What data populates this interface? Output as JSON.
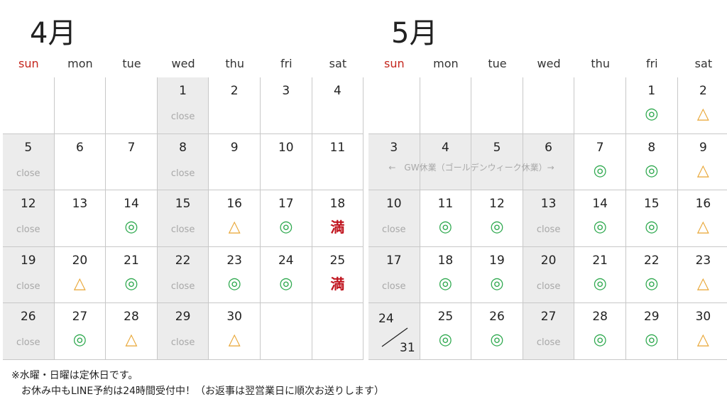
{
  "april": {
    "title": "4月",
    "dow": [
      "sun",
      "mon",
      "tue",
      "wed",
      "thu",
      "fri",
      "sat"
    ],
    "weeks": [
      [
        null,
        null,
        null,
        {
          "d": "1",
          "c": true
        },
        {
          "d": "2"
        },
        {
          "d": "3"
        },
        {
          "d": "4"
        }
      ],
      [
        {
          "d": "5",
          "c": true
        },
        {
          "d": "6"
        },
        {
          "d": "7"
        },
        {
          "d": "8",
          "c": true
        },
        {
          "d": "9"
        },
        {
          "d": "10"
        },
        {
          "d": "11"
        }
      ],
      [
        {
          "d": "12",
          "c": true
        },
        {
          "d": "13"
        },
        {
          "d": "14",
          "s": "◎"
        },
        {
          "d": "15",
          "c": true
        },
        {
          "d": "16",
          "s": "△"
        },
        {
          "d": "17",
          "s": "◎"
        },
        {
          "d": "18",
          "s": "満"
        }
      ],
      [
        {
          "d": "19",
          "c": true
        },
        {
          "d": "20",
          "s": "△"
        },
        {
          "d": "21",
          "s": "◎"
        },
        {
          "d": "22",
          "c": true
        },
        {
          "d": "23",
          "s": "◎"
        },
        {
          "d": "24",
          "s": "◎"
        },
        {
          "d": "25",
          "s": "満"
        }
      ],
      [
        {
          "d": "26",
          "c": true
        },
        {
          "d": "27",
          "s": "◎"
        },
        {
          "d": "28",
          "s": "△"
        },
        {
          "d": "29",
          "c": true
        },
        {
          "d": "30",
          "s": "△"
        },
        null,
        null
      ]
    ]
  },
  "may": {
    "title": "5月",
    "dow": [
      "sun",
      "mon",
      "tue",
      "wed",
      "thu",
      "fri",
      "sat"
    ],
    "weeks": [
      [
        null,
        null,
        null,
        null,
        null,
        {
          "d": "1",
          "s": "◎"
        },
        {
          "d": "2",
          "s": "△"
        }
      ],
      [
        {
          "d": "3",
          "g": true
        },
        {
          "d": "4",
          "g": true
        },
        {
          "d": "5",
          "g": true
        },
        {
          "d": "6",
          "g": true
        },
        {
          "d": "7",
          "s": "◎"
        },
        {
          "d": "8",
          "s": "◎"
        },
        {
          "d": "9",
          "s": "△"
        }
      ],
      [
        {
          "d": "10",
          "c": true
        },
        {
          "d": "11",
          "s": "◎"
        },
        {
          "d": "12",
          "s": "◎"
        },
        {
          "d": "13",
          "c": true
        },
        {
          "d": "14",
          "s": "◎"
        },
        {
          "d": "15",
          "s": "◎"
        },
        {
          "d": "16",
          "s": "△"
        }
      ],
      [
        {
          "d": "17",
          "c": true
        },
        {
          "d": "18",
          "s": "◎"
        },
        {
          "d": "19",
          "s": "◎"
        },
        {
          "d": "20",
          "c": true
        },
        {
          "d": "21",
          "s": "◎"
        },
        {
          "d": "22",
          "s": "◎"
        },
        {
          "d": "23",
          "s": "△"
        }
      ],
      [
        {
          "d": "",
          "split": true,
          "c": true
        },
        {
          "d": "25",
          "s": "◎"
        },
        {
          "d": "26",
          "s": "◎"
        },
        {
          "d": "27",
          "c": true
        },
        {
          "d": "28",
          "s": "◎"
        },
        {
          "d": "29",
          "s": "◎"
        },
        {
          "d": "30",
          "s": "△"
        }
      ]
    ],
    "gw_label": "←　GW休業（ゴールデンウィーク休業）→",
    "split_top": "24",
    "split_bottom": "31"
  },
  "closed_label": "close",
  "notes": {
    "line1": "※水曜・日曜は定休日です。",
    "line2": "　お休み中もLINE予約は24時間受付中！（お返事は翌営業日に順次お送りします）"
  },
  "colors": {
    "sunday": "#c4261d",
    "available": "#2fa94f",
    "few": "#e8a533",
    "full": "#c0141e",
    "closed_bg": "#ececec"
  }
}
